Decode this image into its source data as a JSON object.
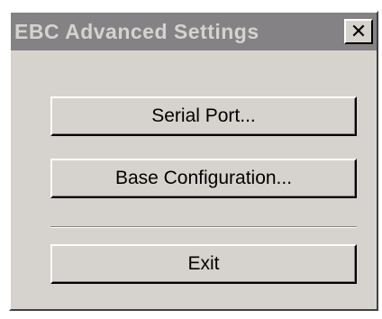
{
  "window": {
    "title": "EBC Advanced Settings",
    "close_glyph": "✕"
  },
  "buttons": {
    "serial_port": "Serial Port...",
    "base_configuration": "Base Configuration...",
    "exit": "Exit"
  },
  "colors": {
    "face": "#d6d3ce",
    "titlebar_inactive": "#848284"
  },
  "icons": {
    "close": "close-icon"
  }
}
